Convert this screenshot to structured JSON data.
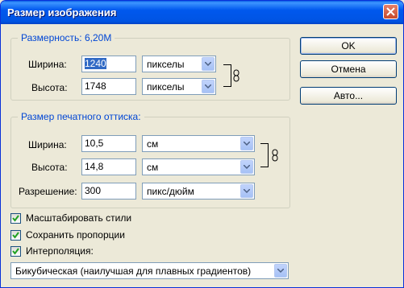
{
  "window": {
    "title": "Размер изображения"
  },
  "pixel_dimensions": {
    "label": "Размерность:",
    "size": "6,20M",
    "width_label": "Ширина:",
    "width_value": "1240",
    "width_unit": "пикселы",
    "height_label": "Высота:",
    "height_value": "1748",
    "height_unit": "пикселы"
  },
  "document_size": {
    "label": "Размер печатного оттиска:",
    "width_label": "Ширина:",
    "width_value": "10,5",
    "width_unit": "см",
    "height_label": "Высота:",
    "height_value": "14,8",
    "height_unit": "см",
    "resolution_label": "Разрешение:",
    "resolution_value": "300",
    "resolution_unit": "пикс/дюйм"
  },
  "buttons": {
    "ok": "OK",
    "cancel": "Отмена",
    "auto": "Авто..."
  },
  "options": {
    "scale_styles": {
      "label": "Масштабировать стили",
      "checked": true
    },
    "constrain_proportions": {
      "label": "Сохранить пропорции",
      "checked": true
    },
    "resample": {
      "label": "Интерполяция:",
      "checked": true
    }
  },
  "resample_method": "Бикубическая (наилучшая для плавных градиентов)",
  "icons": [
    "close-icon",
    "chain-link-icon",
    "dropdown-arrow-icon",
    "checkmark-icon"
  ]
}
